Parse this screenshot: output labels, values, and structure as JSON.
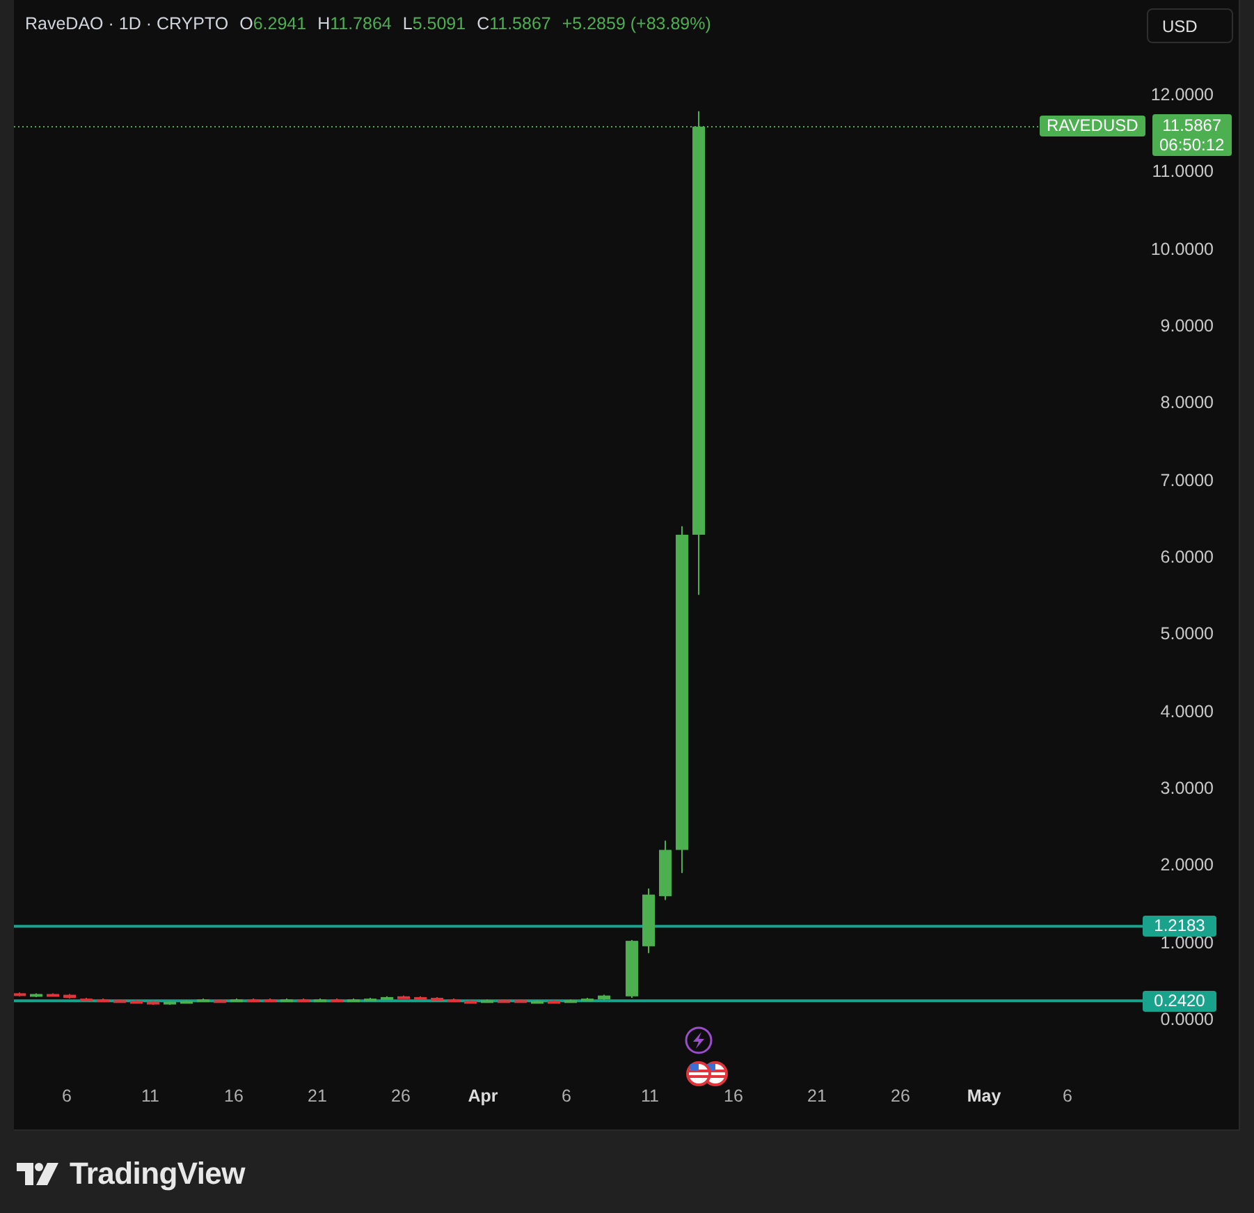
{
  "header": {
    "symbol": "RaveDAO · 1D · CRYPTO",
    "ohlc": [
      {
        "key": "O",
        "value": "6.2941"
      },
      {
        "key": "H",
        "value": "11.7864"
      },
      {
        "key": "L",
        "value": "5.5091"
      },
      {
        "key": "C",
        "value": "11.5867"
      }
    ],
    "change": "+5.2859 (+83.89%)"
  },
  "currency_button": "USD",
  "price_axis": [
    "12.0000",
    "11.0000",
    "10.0000",
    "9.0000",
    "8.0000",
    "7.0000",
    "6.0000",
    "5.0000",
    "4.0000",
    "3.0000",
    "2.0000",
    "1.0000",
    "0.0000"
  ],
  "last_price": {
    "symbol": "RAVEDUSD",
    "price": "11.5867",
    "countdown": "06:50:12"
  },
  "horizontal_lines": [
    {
      "price": "1.2183"
    },
    {
      "price": "0.2420"
    }
  ],
  "time_axis": [
    {
      "label": "6",
      "bold": false
    },
    {
      "label": "11",
      "bold": false
    },
    {
      "label": "16",
      "bold": false
    },
    {
      "label": "21",
      "bold": false
    },
    {
      "label": "26",
      "bold": false
    },
    {
      "label": "Apr",
      "bold": true
    },
    {
      "label": "6",
      "bold": false
    },
    {
      "label": "11",
      "bold": false
    },
    {
      "label": "16",
      "bold": false
    },
    {
      "label": "21",
      "bold": false
    },
    {
      "label": "26",
      "bold": false
    },
    {
      "label": "May",
      "bold": true
    },
    {
      "label": "6",
      "bold": false
    }
  ],
  "brand": "TradingView"
}
